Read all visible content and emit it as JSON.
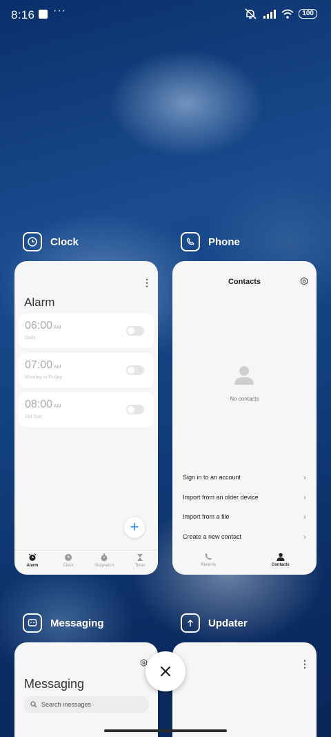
{
  "status_bar": {
    "time": "8:16",
    "dots": "···",
    "battery": "100"
  },
  "clock": {
    "app_name": "Clock",
    "kebab": "⋮",
    "alarm_title": "Alarm",
    "alarms": [
      {
        "time": "06:00",
        "ampm": "AM",
        "repeat": "Daily",
        "enabled": false
      },
      {
        "time": "07:00",
        "ampm": "AM",
        "repeat": "Monday to Friday",
        "enabled": false
      },
      {
        "time": "08:00",
        "ampm": "AM",
        "repeat": "Sat Sun",
        "enabled": false
      }
    ],
    "fab": "+",
    "tabs": [
      {
        "label": "Alarm",
        "icon": "alarm-icon",
        "active": true
      },
      {
        "label": "Clock",
        "icon": "clock-icon",
        "active": false
      },
      {
        "label": "Stopwatch",
        "icon": "stopwatch-icon",
        "active": false
      },
      {
        "label": "Timer",
        "icon": "hourglass-icon",
        "active": false
      }
    ]
  },
  "phone": {
    "app_name": "Phone",
    "title": "Contacts",
    "empty_text": "No contacts",
    "menu": [
      {
        "label": "Sign in to an account"
      },
      {
        "label": "Import from an older device"
      },
      {
        "label": "Import from a file"
      },
      {
        "label": "Create a new contact"
      }
    ],
    "chevron": "›",
    "tabs": [
      {
        "label": "Recents",
        "icon": "phone-icon",
        "active": false
      },
      {
        "label": "Contacts",
        "icon": "person-icon",
        "active": true
      }
    ]
  },
  "messaging": {
    "app_name": "Messaging",
    "title": "Messaging",
    "search_placeholder": "Search messages"
  },
  "updater": {
    "app_name": "Updater",
    "kebab": "⋮"
  },
  "colors": {
    "accent": "#2f88f0",
    "card_bg": "#f6f6f6",
    "text": "#222222"
  }
}
